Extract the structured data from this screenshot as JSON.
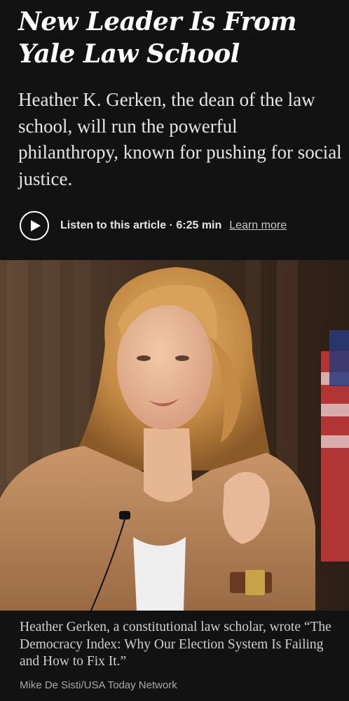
{
  "article": {
    "headline_line1": "New Leader Is From",
    "headline_line2": "Yale Law School",
    "summary": "Heather K. Gerken, the dean of the law school, will run the powerful philanthropy, known for pushing for social justice."
  },
  "audio": {
    "play_icon": "play-icon",
    "listen_text": "Listen to this article · 6:25 min",
    "learn_more": "Learn more"
  },
  "photo": {
    "caption": "Heather Gerken, a constitutional law scholar, wrote “The Democracy Index: Why Our Election System Is Failing and How to Fix It.”",
    "credit": "Mike De Sisti/USA Today Network"
  },
  "colors": {
    "background": "#121212",
    "text_primary": "#ffffff",
    "text_secondary": "#a8a8a8"
  }
}
